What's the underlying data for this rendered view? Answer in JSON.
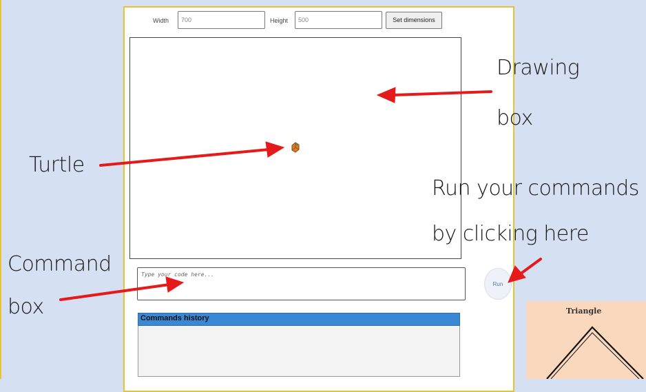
{
  "dimensions": {
    "width_label": "Width",
    "width_value": "700",
    "height_label": "Height",
    "height_value": "500",
    "set_button_label": "Set dimensions"
  },
  "command_box": {
    "placeholder": "Type your code here..."
  },
  "run_button": {
    "label": "Run"
  },
  "history": {
    "header": "Commands history"
  },
  "annotations": {
    "drawing_line1": "Drawing",
    "drawing_line2": "box",
    "turtle": "Turtle",
    "run_line1": "Run your commands",
    "run_line2": "by clicking here",
    "command_line1": "Command",
    "command_line2": "box"
  },
  "example_card": {
    "title": "Triangle"
  },
  "colors": {
    "page_background": "#d5e0f2",
    "panel_border": "#e9c232",
    "arrow": "#e51b1b",
    "history_header": "#3a88d4",
    "turtle": "#e07a2a",
    "card_background": "#f9d8bd"
  },
  "icons": {
    "turtle": "turtle-icon"
  }
}
